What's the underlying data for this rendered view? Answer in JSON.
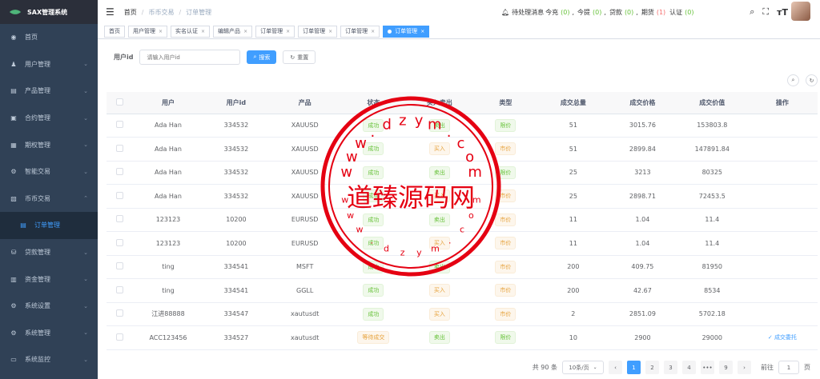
{
  "app": {
    "title": "SAX管理系统"
  },
  "sidebar": {
    "items": [
      {
        "label": "首页",
        "icon": "dashboard-icon",
        "glyph": "◉",
        "arrow": ""
      },
      {
        "label": "用户管理",
        "icon": "user-icon",
        "glyph": "♟",
        "arrow": "⌄"
      },
      {
        "label": "产品管理",
        "icon": "product-icon",
        "glyph": "▤",
        "arrow": "⌄"
      },
      {
        "label": "合约管理",
        "icon": "contract-icon",
        "glyph": "▣",
        "arrow": "⌄"
      },
      {
        "label": "期权管理",
        "icon": "option-icon",
        "glyph": "▦",
        "arrow": "⌄"
      },
      {
        "label": "智能交易",
        "icon": "robot-icon",
        "glyph": "⚙",
        "arrow": "⌄"
      },
      {
        "label": "币币交易",
        "icon": "exchange-icon",
        "glyph": "▧",
        "arrow": "⌃"
      },
      {
        "label": "订单管理",
        "icon": "order-icon",
        "glyph": "▤",
        "arrow": ""
      },
      {
        "label": "贷款管理",
        "icon": "loan-icon",
        "glyph": "⛁",
        "arrow": "⌄"
      },
      {
        "label": "资金管理",
        "icon": "fund-icon",
        "glyph": "▥",
        "arrow": "⌄"
      },
      {
        "label": "系统设置",
        "icon": "settings-icon",
        "glyph": "⚙",
        "arrow": "⌄"
      },
      {
        "label": "系统管理",
        "icon": "system-icon",
        "glyph": "⚙",
        "arrow": "⌄"
      },
      {
        "label": "系统监控",
        "icon": "monitor-icon",
        "glyph": "▭",
        "arrow": "⌄"
      }
    ]
  },
  "header": {
    "breadcrumb": [
      "首页",
      "币币交易",
      "订单管理"
    ],
    "notify": {
      "pending": "待处理消息",
      "recharge_label": "今充",
      "recharge": "(0)",
      "withdraw_label": "今提",
      "withdraw": "(0)",
      "loan_label": "贷款",
      "loan": "(0)",
      "option_label": "期货",
      "option": "(1)",
      "auth_label": "认证",
      "auth": "(0)"
    }
  },
  "tags": [
    {
      "label": "首页",
      "closable": false,
      "active": false
    },
    {
      "label": "用户管理",
      "closable": true,
      "active": false
    },
    {
      "label": "实名认证",
      "closable": true,
      "active": false
    },
    {
      "label": "编辑产品",
      "closable": true,
      "active": false
    },
    {
      "label": "订单管理",
      "closable": true,
      "active": false
    },
    {
      "label": "订单管理",
      "closable": true,
      "active": false
    },
    {
      "label": "订单管理",
      "closable": true,
      "active": false
    },
    {
      "label": "订单管理",
      "closable": true,
      "active": true
    }
  ],
  "search": {
    "label": "用户id",
    "placeholder": "请输入用户id",
    "search_btn": "搜索",
    "reset_btn": "重置"
  },
  "table": {
    "headers": [
      "用户",
      "用户id",
      "产品",
      "状态",
      "买入卖出",
      "类型",
      "成交总量",
      "成交价格",
      "成交价值",
      "操作"
    ],
    "rows": [
      [
        "Ada Han",
        "334532",
        "XAUUSD",
        "成功",
        "卖出",
        "限价",
        "51",
        "3015.76",
        "153803.8",
        ""
      ],
      [
        "Ada Han",
        "334532",
        "XAUUSD",
        "成功",
        "买入",
        "市价",
        "51",
        "2899.84",
        "147891.84",
        ""
      ],
      [
        "Ada Han",
        "334532",
        "XAUUSD",
        "成功",
        "卖出",
        "限价",
        "25",
        "3213",
        "80325",
        ""
      ],
      [
        "Ada Han",
        "334532",
        "XAUUSD",
        "成功",
        "买入",
        "市价",
        "25",
        "2898.71",
        "72453.5",
        ""
      ],
      [
        "123123",
        "10200",
        "EURUSD",
        "成功",
        "卖出",
        "市价",
        "11",
        "1.04",
        "11.4",
        ""
      ],
      [
        "123123",
        "10200",
        "EURUSD",
        "成功",
        "买入",
        "市价",
        "11",
        "1.04",
        "11.4",
        ""
      ],
      [
        "ting",
        "334541",
        "MSFT",
        "成功",
        "卖出",
        "市价",
        "200",
        "409.75",
        "81950",
        ""
      ],
      [
        "ting",
        "334541",
        "GGLL",
        "成功",
        "买入",
        "市价",
        "200",
        "42.67",
        "8534",
        ""
      ],
      [
        "江进88888",
        "334547",
        "xautusdt",
        "成功",
        "买入",
        "市价",
        "2",
        "2851.09",
        "5702.18",
        ""
      ],
      [
        "ACC123456",
        "334527",
        "xautusdt",
        "等待成交",
        "卖出",
        "限价",
        "10",
        "2900",
        "29000",
        "成交委托"
      ]
    ]
  },
  "pagination": {
    "total": "共 90 条",
    "page_size": "10条/页",
    "pages": [
      "1",
      "2",
      "3",
      "4",
      "•••",
      "9"
    ],
    "goto_label": "前往",
    "goto_value": "1",
    "goto_suffix": "页"
  },
  "watermark": {
    "name": "道臻源码网",
    "url": "www.dzym.com"
  },
  "colors": {
    "sidebar": "#304156",
    "primary": "#409eff",
    "success": "#67c23a",
    "danger": "#f56c6c",
    "stamp": "#e50012"
  }
}
